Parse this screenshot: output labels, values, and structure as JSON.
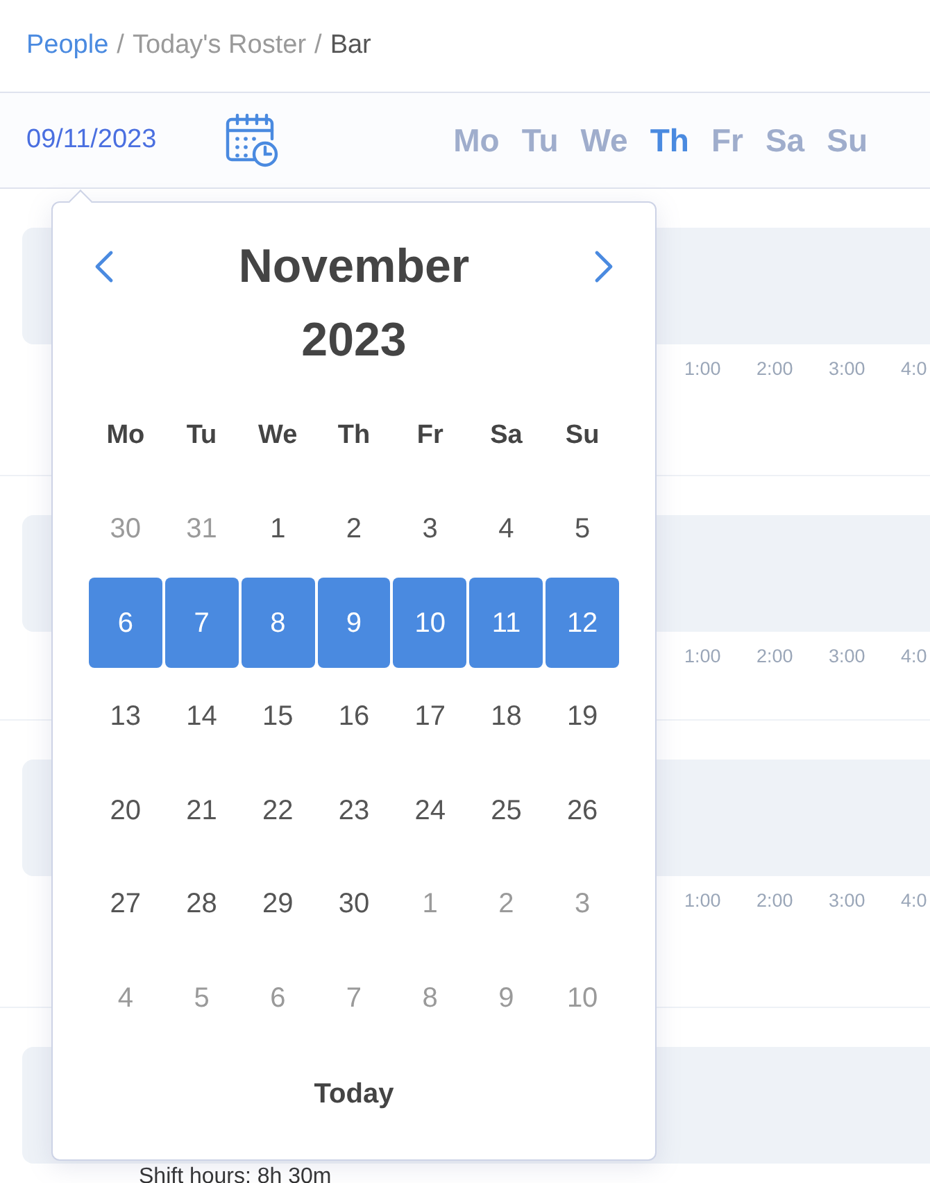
{
  "breadcrumb": {
    "separator": "/",
    "items": [
      {
        "text": "People",
        "kind": "link"
      },
      {
        "text": "Today's Roster",
        "kind": "muted"
      },
      {
        "text": "Bar",
        "kind": "current"
      }
    ]
  },
  "week_bar": {
    "date": "09/11/2023",
    "days": [
      {
        "label": "Mo",
        "selected": false
      },
      {
        "label": "Tu",
        "selected": false
      },
      {
        "label": "We",
        "selected": false
      },
      {
        "label": "Th",
        "selected": true
      },
      {
        "label": "Fr",
        "selected": false
      },
      {
        "label": "Sa",
        "selected": false
      },
      {
        "label": "Su",
        "selected": false
      }
    ]
  },
  "roster": {
    "rows": [
      {
        "time_labels": [
          "1:00",
          "2:00",
          "3:00",
          "4:0"
        ]
      },
      {
        "time_labels": [
          "1:00",
          "2:00",
          "3:00",
          "4:0"
        ]
      },
      {
        "time_labels": [
          "1:00",
          "2:00",
          "3:00",
          "4:0"
        ]
      },
      {
        "time_labels": []
      }
    ],
    "footer": "Shift hours: 8h 30m"
  },
  "calendar": {
    "title": "November 2023",
    "weekdays": [
      "Mo",
      "Tu",
      "We",
      "Th",
      "Fr",
      "Sa",
      "Su"
    ],
    "weeks": [
      {
        "selected": false,
        "days": [
          {
            "label": "30",
            "outside": true
          },
          {
            "label": "31",
            "outside": true
          },
          {
            "label": "1",
            "outside": false
          },
          {
            "label": "2",
            "outside": false
          },
          {
            "label": "3",
            "outside": false
          },
          {
            "label": "4",
            "outside": false
          },
          {
            "label": "5",
            "outside": false
          }
        ]
      },
      {
        "selected": true,
        "days": [
          {
            "label": "6",
            "outside": false
          },
          {
            "label": "7",
            "outside": false
          },
          {
            "label": "8",
            "outside": false
          },
          {
            "label": "9",
            "outside": false
          },
          {
            "label": "10",
            "outside": false
          },
          {
            "label": "11",
            "outside": false
          },
          {
            "label": "12",
            "outside": false
          }
        ]
      },
      {
        "selected": false,
        "days": [
          {
            "label": "13",
            "outside": false
          },
          {
            "label": "14",
            "outside": false
          },
          {
            "label": "15",
            "outside": false
          },
          {
            "label": "16",
            "outside": false
          },
          {
            "label": "17",
            "outside": false
          },
          {
            "label": "18",
            "outside": false
          },
          {
            "label": "19",
            "outside": false
          }
        ]
      },
      {
        "selected": false,
        "days": [
          {
            "label": "20",
            "outside": false
          },
          {
            "label": "21",
            "outside": false
          },
          {
            "label": "22",
            "outside": false
          },
          {
            "label": "23",
            "outside": false
          },
          {
            "label": "24",
            "outside": false
          },
          {
            "label": "25",
            "outside": false
          },
          {
            "label": "26",
            "outside": false
          }
        ]
      },
      {
        "selected": false,
        "days": [
          {
            "label": "27",
            "outside": false
          },
          {
            "label": "28",
            "outside": false
          },
          {
            "label": "29",
            "outside": false
          },
          {
            "label": "30",
            "outside": false
          },
          {
            "label": "1",
            "outside": true
          },
          {
            "label": "2",
            "outside": true
          },
          {
            "label": "3",
            "outside": true
          }
        ]
      },
      {
        "selected": false,
        "days": [
          {
            "label": "4",
            "outside": true
          },
          {
            "label": "5",
            "outside": true
          },
          {
            "label": "6",
            "outside": true
          },
          {
            "label": "7",
            "outside": true
          },
          {
            "label": "8",
            "outside": true
          },
          {
            "label": "9",
            "outside": true
          },
          {
            "label": "10",
            "outside": true
          }
        ]
      }
    ],
    "today_button": "Today"
  }
}
